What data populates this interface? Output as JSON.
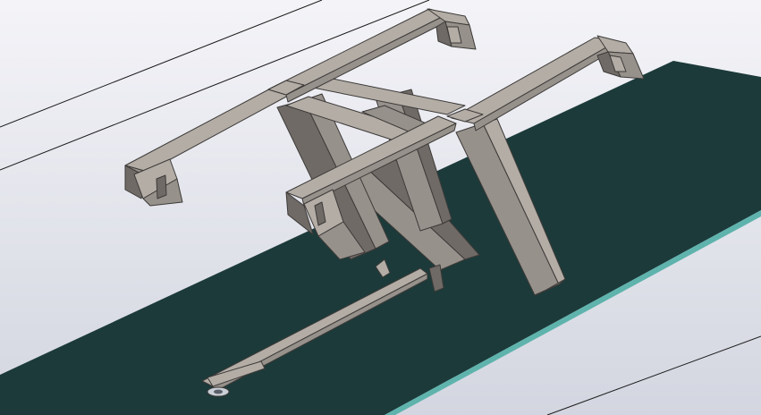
{
  "view": {
    "background_top": "#f4f4f8",
    "background_bottom": "#d3d6e0",
    "guide_line_color": "#1c1c1c"
  },
  "model": {
    "substrate_color": "#1c3a3a",
    "substrate_edge_color": "#5fb3ad",
    "metal_light": "#b3ada6",
    "metal_mid": "#97918b",
    "metal_dark": "#6f6a66",
    "edge_color": "#3d3a38",
    "feed_pin_color": "#c9cfd6"
  }
}
